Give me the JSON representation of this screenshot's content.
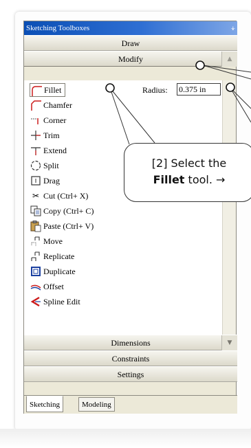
{
  "panel": {
    "title": "Sketching Toolboxes",
    "pin_icon": "pin-icon"
  },
  "sections": {
    "draw": "Draw",
    "modify": "Modify",
    "dimensions": "Dimensions",
    "constraints": "Constraints",
    "settings": "Settings"
  },
  "tools": [
    {
      "label": "Fillet",
      "icon": "fillet-icon",
      "selected": true
    },
    {
      "label": "Chamfer",
      "icon": "chamfer-icon"
    },
    {
      "label": "Corner",
      "icon": "corner-icon"
    },
    {
      "label": "Trim",
      "icon": "trim-icon"
    },
    {
      "label": "Extend",
      "icon": "extend-icon"
    },
    {
      "label": "Split",
      "icon": "split-icon"
    },
    {
      "label": "Drag",
      "icon": "drag-icon"
    },
    {
      "label": "Cut (Ctrl+ X)",
      "icon": "scissors-icon"
    },
    {
      "label": "Copy (Ctrl+ C)",
      "icon": "copy-icon"
    },
    {
      "label": "Paste (Ctrl+ V)",
      "icon": "paste-icon"
    },
    {
      "label": "Move",
      "icon": "move-icon"
    },
    {
      "label": "Replicate",
      "icon": "replicate-icon"
    },
    {
      "label": "Duplicate",
      "icon": "duplicate-icon"
    },
    {
      "label": "Offset",
      "icon": "offset-icon"
    },
    {
      "label": "Spline Edit",
      "icon": "spline-edit-icon"
    }
  ],
  "radius": {
    "label": "Radius:",
    "value": "0.375 in"
  },
  "tabs": {
    "sketching": "Sketching",
    "modeling": "Modeling"
  },
  "callout": {
    "prefix": "[2] Select the",
    "bold": "Fillet",
    "suffix": "tool.",
    "arrow": "→"
  },
  "colors": {
    "title_bar": "#0b4fb5",
    "panel_bg": "#ece9d8",
    "list_bg": "#ffffff",
    "icon_red": "#cc1a1a"
  }
}
